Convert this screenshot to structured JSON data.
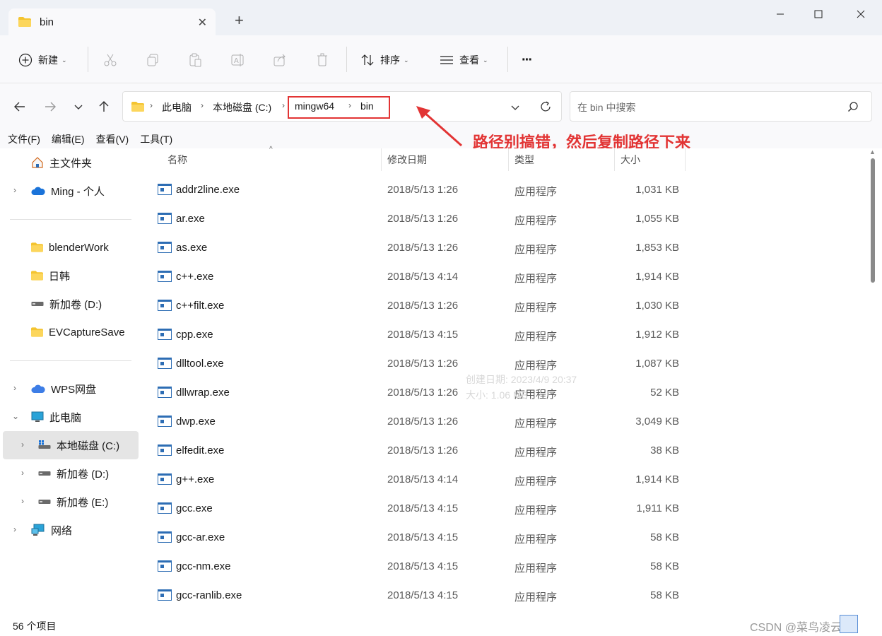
{
  "window": {
    "tab_title": "bin",
    "new_tab_symbol": "+",
    "close_symbol": "✕"
  },
  "toolbar": {
    "new_label": "新建",
    "sort_label": "排序",
    "view_label": "查看",
    "more_symbol": "···"
  },
  "address": {
    "crumbs": [
      "此电脑",
      "本地磁盘 (C:)",
      "mingw64",
      "bin"
    ],
    "search_placeholder": "在 bin 中搜索"
  },
  "menubar": {
    "items": [
      "文件(F)",
      "编辑(E)",
      "查看(V)",
      "工具(T)"
    ]
  },
  "annotation": {
    "text": "路径别搞错，然后复制路径下来",
    "color": "#e23434"
  },
  "sidebar": {
    "items": [
      {
        "label": "主文件夹",
        "icon": "home-icon"
      },
      {
        "label": "Ming - 个人",
        "icon": "cloud-icon"
      },
      {
        "label": "blenderWork",
        "icon": "folder-icon"
      },
      {
        "label": "日韩",
        "icon": "folder-icon"
      },
      {
        "label": "新加卷 (D:)",
        "icon": "drive-icon"
      },
      {
        "label": "EVCaptureSave",
        "icon": "folder-icon"
      },
      {
        "label": "WPS网盘",
        "icon": "cloud-icon"
      },
      {
        "label": "此电脑",
        "icon": "computer-icon"
      },
      {
        "label": "本地磁盘 (C:)",
        "icon": "windows-drive-icon"
      },
      {
        "label": "新加卷 (D:)",
        "icon": "drive-icon"
      },
      {
        "label": "新加卷 (E:)",
        "icon": "drive-icon"
      },
      {
        "label": "网络",
        "icon": "network-icon"
      }
    ]
  },
  "filelist": {
    "columns": [
      "名称",
      "修改日期",
      "类型",
      "大小"
    ],
    "rows": [
      {
        "name": "addr2line.exe",
        "date": "2018/5/13 1:26",
        "type": "应用程序",
        "size": "1,031 KB"
      },
      {
        "name": "ar.exe",
        "date": "2018/5/13 1:26",
        "type": "应用程序",
        "size": "1,055 KB"
      },
      {
        "name": "as.exe",
        "date": "2018/5/13 1:26",
        "type": "应用程序",
        "size": "1,853 KB"
      },
      {
        "name": "c++.exe",
        "date": "2018/5/13 4:14",
        "type": "应用程序",
        "size": "1,914 KB"
      },
      {
        "name": "c++filt.exe",
        "date": "2018/5/13 1:26",
        "type": "应用程序",
        "size": "1,030 KB"
      },
      {
        "name": "cpp.exe",
        "date": "2018/5/13 4:15",
        "type": "应用程序",
        "size": "1,912 KB"
      },
      {
        "name": "dlltool.exe",
        "date": "2018/5/13 1:26",
        "type": "应用程序",
        "size": "1,087 KB"
      },
      {
        "name": "dllwrap.exe",
        "date": "2018/5/13 1:26",
        "type": "应用程序",
        "size": "52 KB"
      },
      {
        "name": "dwp.exe",
        "date": "2018/5/13 1:26",
        "type": "应用程序",
        "size": "3,049 KB"
      },
      {
        "name": "elfedit.exe",
        "date": "2018/5/13 1:26",
        "type": "应用程序",
        "size": "38 KB"
      },
      {
        "name": "g++.exe",
        "date": "2018/5/13 4:14",
        "type": "应用程序",
        "size": "1,914 KB"
      },
      {
        "name": "gcc.exe",
        "date": "2018/5/13 4:15",
        "type": "应用程序",
        "size": "1,911 KB"
      },
      {
        "name": "gcc-ar.exe",
        "date": "2018/5/13 4:15",
        "type": "应用程序",
        "size": "58 KB"
      },
      {
        "name": "gcc-nm.exe",
        "date": "2018/5/13 4:15",
        "type": "应用程序",
        "size": "58 KB"
      },
      {
        "name": "gcc-ranlib.exe",
        "date": "2018/5/13 4:15",
        "type": "应用程序",
        "size": "58 KB"
      }
    ],
    "tooltip_line1": "创建日期: 2023/4/9 20:37",
    "tooltip_line2": "大小: 1.06 MB"
  },
  "status": {
    "count_text": "56 个项目",
    "watermark": "CSDN @菜鸟凌云志"
  }
}
